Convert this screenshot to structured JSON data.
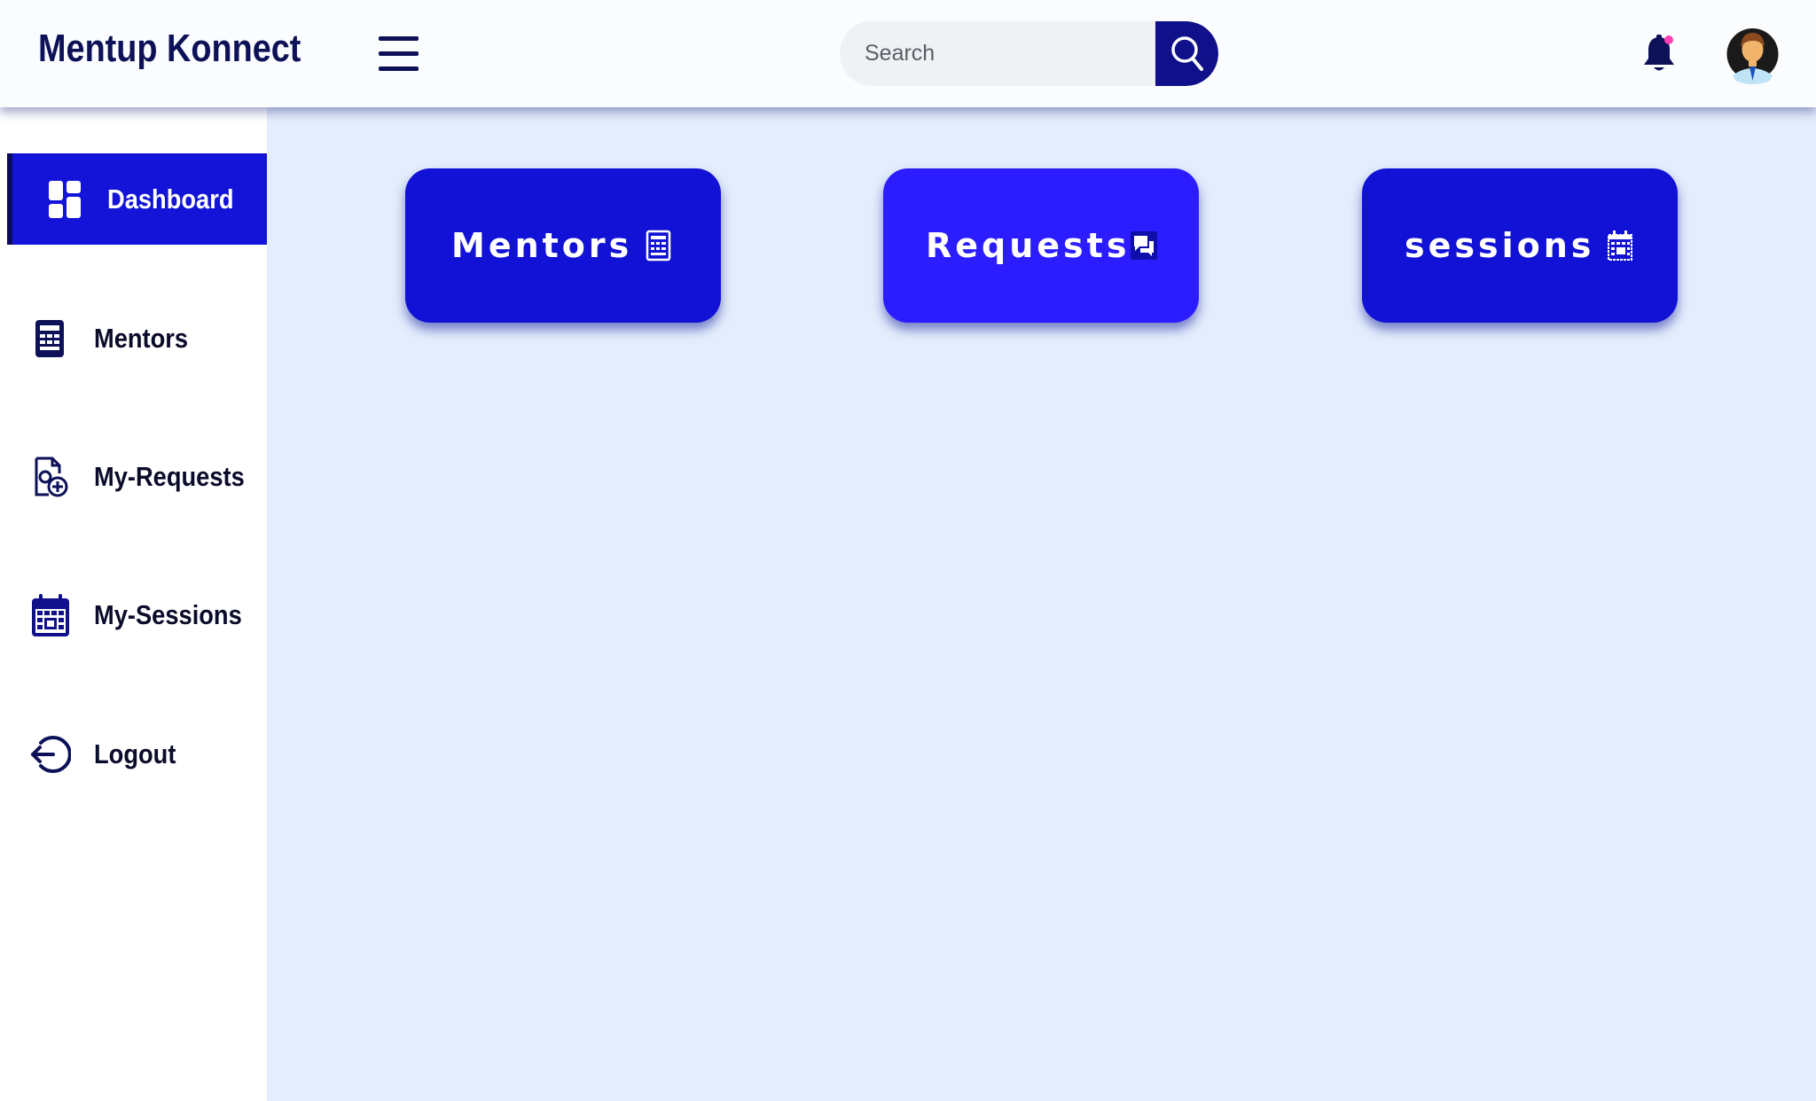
{
  "app": {
    "title": "Mentup Konnect"
  },
  "search": {
    "placeholder": "Search"
  },
  "sidebar": {
    "items": [
      {
        "label": "Dashboard",
        "icon": "dashboard-icon",
        "active": true
      },
      {
        "label": "Mentors",
        "icon": "document-icon",
        "active": false
      },
      {
        "label": "My-Requests",
        "icon": "request-file-icon",
        "active": false
      },
      {
        "label": "My-Sessions",
        "icon": "calendar-icon",
        "active": false
      },
      {
        "label": "Logout",
        "icon": "logout-icon",
        "active": false
      }
    ]
  },
  "cards": [
    {
      "label": "Mentors",
      "icon": "document-icon",
      "color": "#1212d6"
    },
    {
      "label": "Requests",
      "icon": "chat-icon",
      "color": "#2b1dff"
    },
    {
      "label": "sessions",
      "icon": "calendar-icon",
      "color": "#1212d6"
    }
  ],
  "colors": {
    "brand": "#0d1157",
    "accent": "#1414d8",
    "notification_dot": "#ff3fb4",
    "content_background": "#e3edfc"
  }
}
